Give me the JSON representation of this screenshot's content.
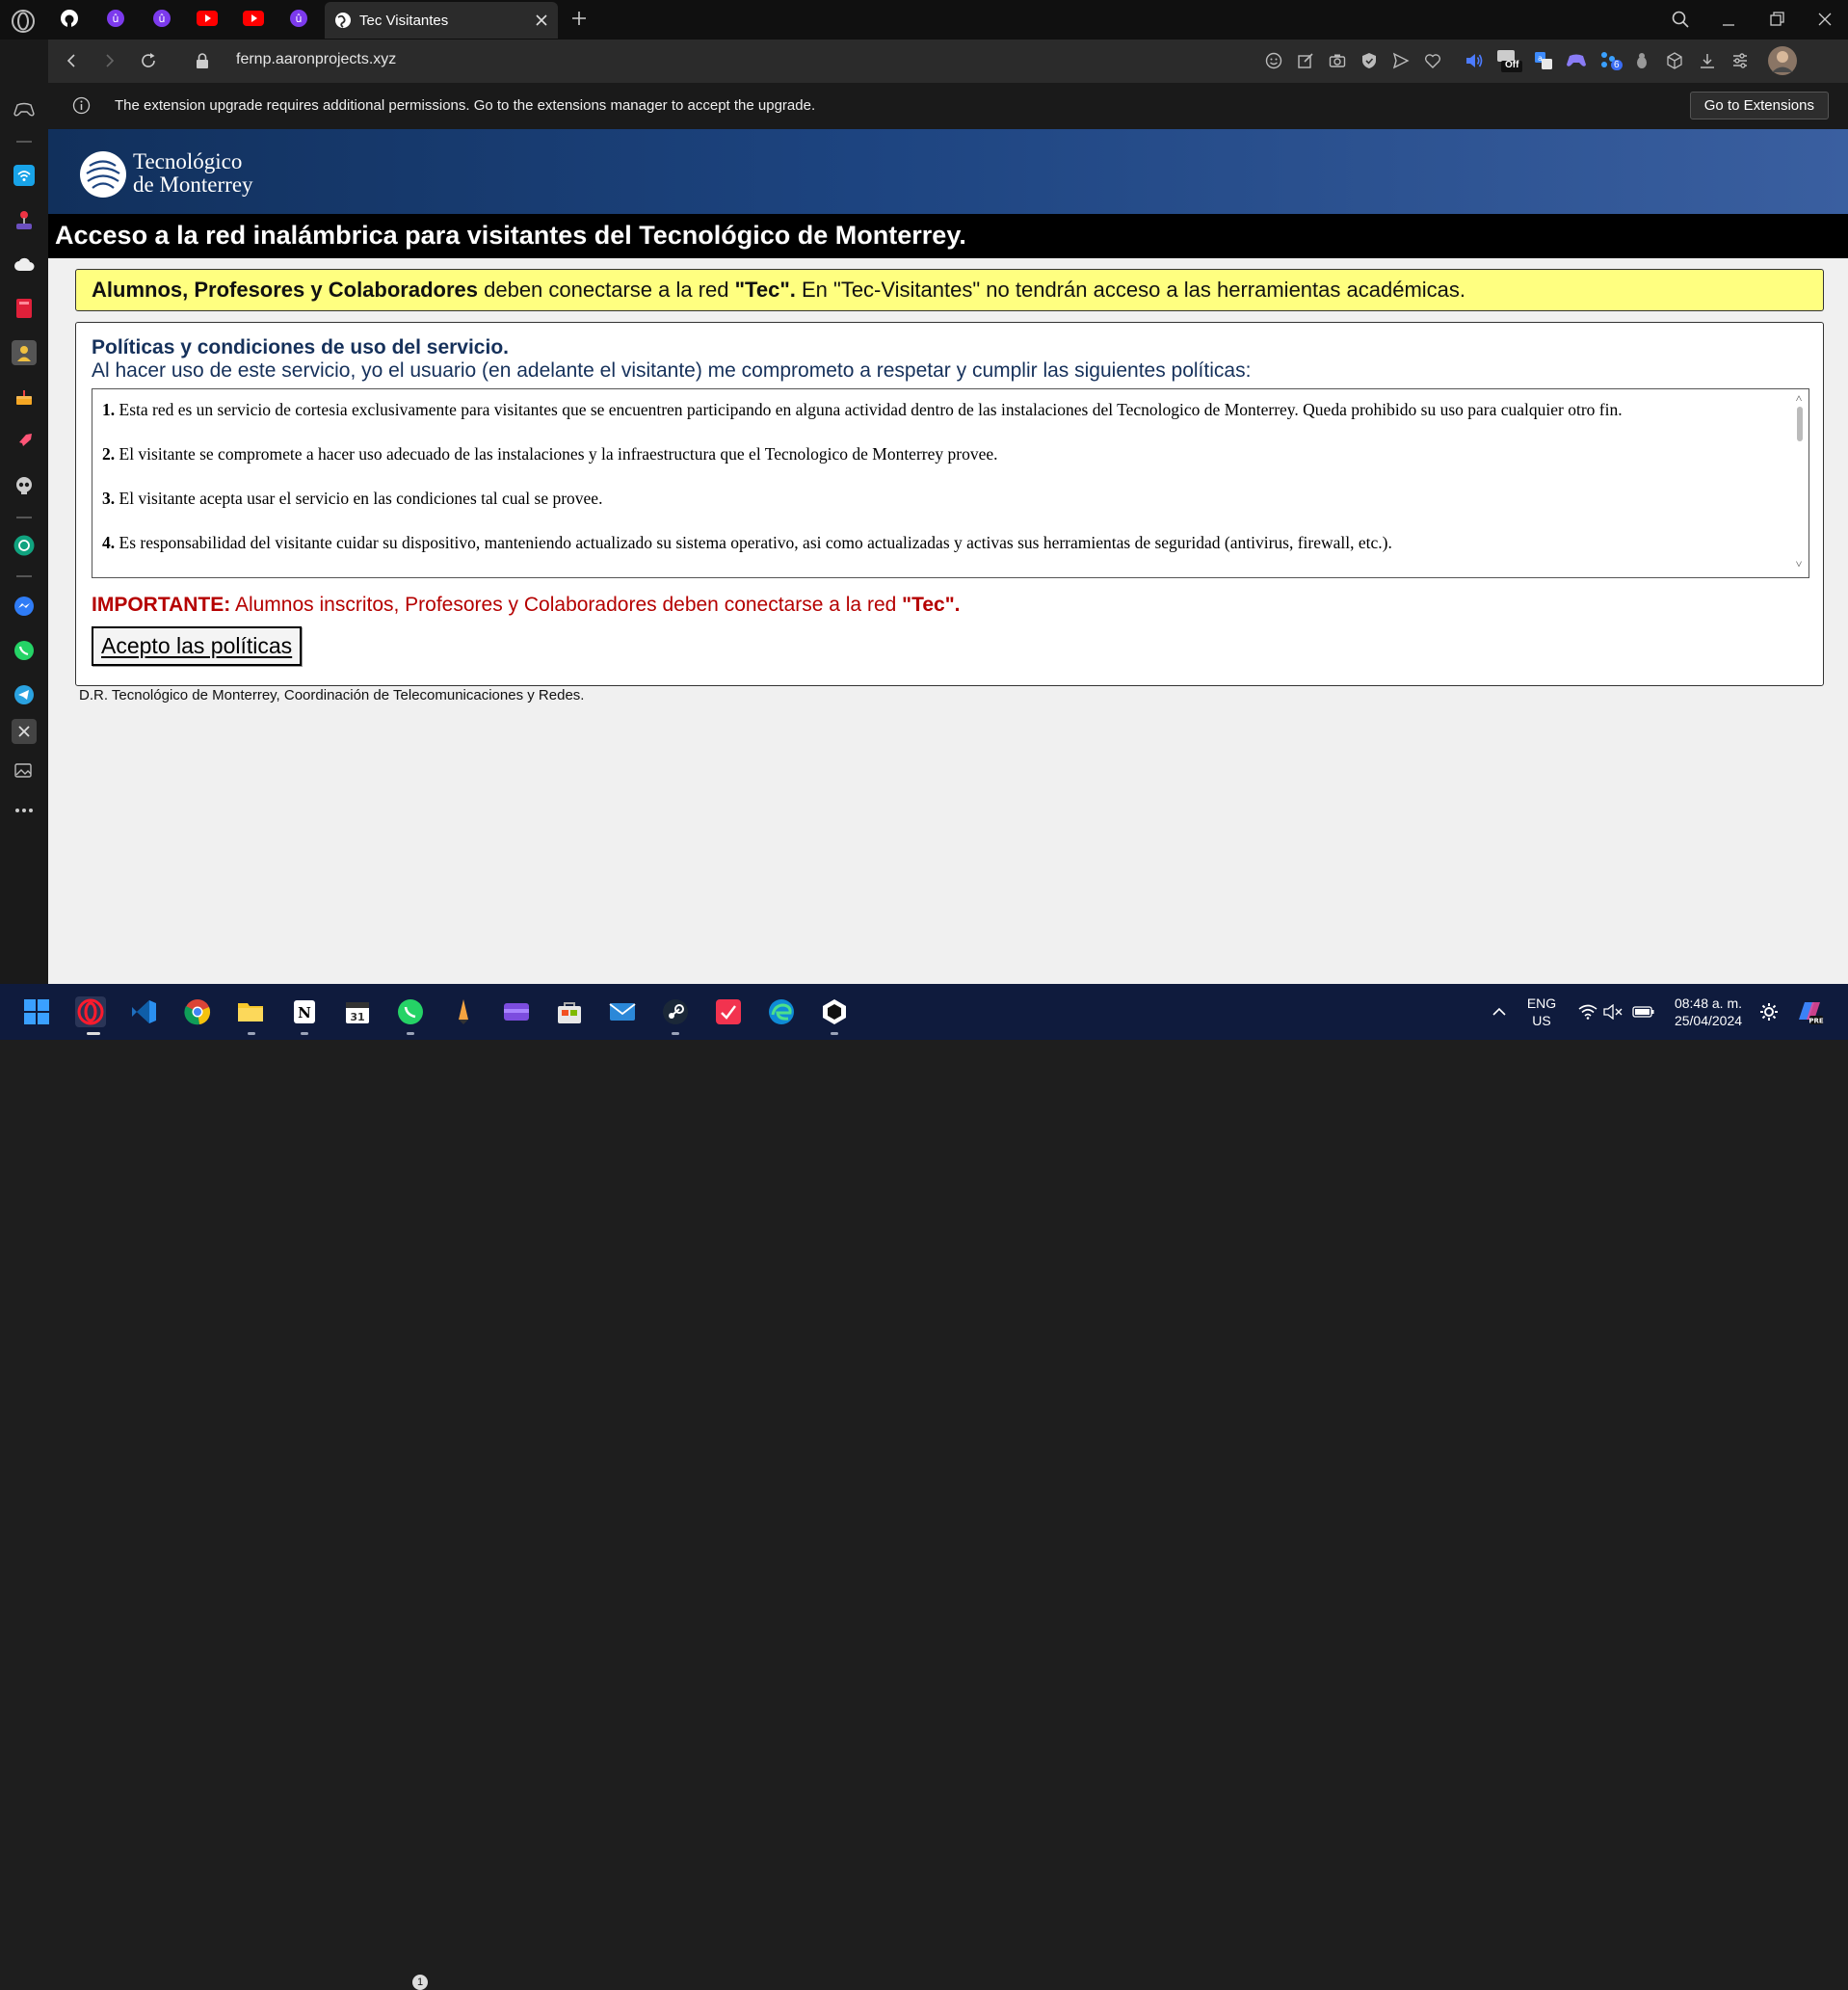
{
  "browser": {
    "active_tab_title": "Tec Visitantes",
    "url": "fernp.aaronprojects.xyz",
    "ext_badge_off": "Off",
    "ext_badge_count": "6"
  },
  "infobar": {
    "message": "The extension upgrade requires additional permissions. Go to the extensions manager to accept the upgrade.",
    "button": "Go to Extensions"
  },
  "page": {
    "logo_line1": "Tecnológico",
    "logo_line2": "de Monterrey",
    "title": "Acceso a la red inalámbrica para visitantes del Tecnológico de Monterrey.",
    "notice": {
      "bold1": "Alumnos, Profesores y Colaboradores",
      "text1": " deben conectarse a la red ",
      "bold2": "\"Tec\".",
      "text2": " En \"Tec-Visitantes\" no tendrán acceso a las herramientas académicas."
    },
    "policies_title": "Políticas y condiciones de uso del servicio.",
    "policies_subtitle": "Al hacer uso de este servicio, yo el usuario (en adelante el visitante) me comprometo a respetar y cumplir las siguientes políticas:",
    "policies": [
      {
        "num": "1.",
        "text": " Esta red es un servicio de cortesia exclusivamente para visitantes que se encuentren participando en alguna actividad dentro de las instalaciones del Tecnologico de Monterrey. Queda prohibido su uso para cualquier otro fin."
      },
      {
        "num": "2.",
        "text": " El visitante se compromete a hacer uso adecuado de las instalaciones y la infraestructura que el Tecnologico de Monterrey provee."
      },
      {
        "num": "3.",
        "text": " El visitante acepta usar el servicio en las condiciones tal cual se provee."
      },
      {
        "num": "4.",
        "text": " Es responsabilidad del visitante cuidar su dispositivo, manteniendo actualizado su sistema operativo, asi como actualizadas y activas sus herramientas de seguridad (antivirus, firewall, etc.)."
      }
    ],
    "important_label": "IMPORTANTE:",
    "important_text": " Alumnos inscritos, Profesores y Colaboradores deben conectarse a la red ",
    "important_bold": "\"Tec\".",
    "accept_button": "Acepto las políticas",
    "footer": "D.R. Tecnológico de Monterrey, Coordinación de Telecomunicaciones y Redes."
  },
  "taskbar": {
    "whatsapp_badge": "1",
    "lang_line1": "ENG",
    "lang_line2": "US",
    "time": "08:48 a. m.",
    "date": "25/04/2024"
  },
  "colors": {
    "header_blue": "#1d4480",
    "notice_yellow": "#ffff80",
    "important_red": "#b50000",
    "title_navy": "#16315b"
  }
}
